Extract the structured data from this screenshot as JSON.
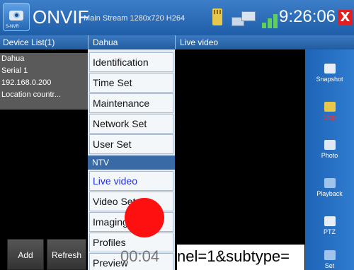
{
  "topbar": {
    "title": "ONVIF",
    "stream_info": "Main Stream 1280x720 H264",
    "time": "9:26:06",
    "close_label": "X",
    "logo_tag": "S-NVR"
  },
  "headers": {
    "device_list": "Device List(1)",
    "menu": "Dahua",
    "video": "Live video"
  },
  "device": {
    "name": "Dahua",
    "serial": "Serial 1",
    "ip": "192.168.0.200",
    "location": "Location countr..."
  },
  "buttons": {
    "add": "Add",
    "refresh": "Refresh"
  },
  "menu": {
    "items_top": [
      "Identification",
      "Time Set",
      "Maintenance",
      "Network Set",
      "User Set"
    ],
    "section": "NTV",
    "items_bottom": [
      "Live video",
      "Video Set",
      "Imaging",
      "Profiles",
      "Preview"
    ]
  },
  "overlay": {
    "time": "00:04",
    "url": "nel=1&subtype="
  },
  "toolbar": [
    {
      "label": "Snapshot",
      "icon": "camera-icon"
    },
    {
      "label": "Stop",
      "icon": "stop-icon"
    },
    {
      "label": "Photo",
      "icon": "photo-icon"
    },
    {
      "label": "Playback",
      "icon": "playback-icon"
    },
    {
      "label": "PTZ",
      "icon": "ptz-icon"
    },
    {
      "label": "Set",
      "icon": "settings-icon"
    }
  ]
}
